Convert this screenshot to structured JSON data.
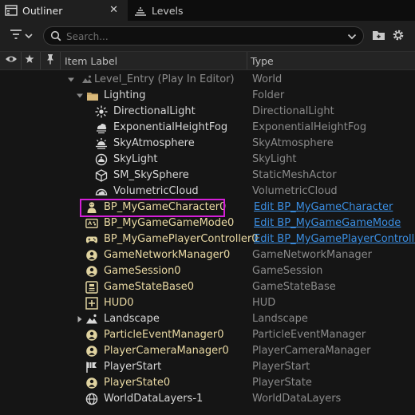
{
  "tabs": [
    {
      "label": "Outliner",
      "icon": "outliner-icon",
      "active": true,
      "close": "✕"
    },
    {
      "label": "Levels",
      "icon": "levels-icon",
      "active": false
    }
  ],
  "toolbar": {
    "search_placeholder": "Search...",
    "filter_icon": "filter-icon",
    "add_folder_icon": "add-folder-icon",
    "settings_icon": "gear-icon"
  },
  "columns": {
    "visibility_icon": "eye-icon",
    "favorite_icon": "star-icon",
    "pin_icon": "pin-icon",
    "item_label": "Item Label",
    "type": "Type"
  },
  "rows": [
    {
      "label": "Level_Entry (Play In Editor)",
      "type": "World",
      "icon": "world-icon",
      "twisty": "expanded",
      "style": "dim"
    },
    {
      "label": "Lighting",
      "type": "Folder",
      "icon": "folder-icon",
      "twisty": "expanded",
      "style": "white"
    },
    {
      "label": "DirectionalLight",
      "type": "DirectionalLight",
      "icon": "directional-light-icon",
      "style": "white"
    },
    {
      "label": "ExponentialHeightFog",
      "type": "ExponentialHeightFog",
      "icon": "height-fog-icon",
      "style": "white"
    },
    {
      "label": "SkyAtmosphere",
      "type": "SkyAtmosphere",
      "icon": "sky-atmosphere-icon",
      "style": "white"
    },
    {
      "label": "SkyLight",
      "type": "SkyLight",
      "icon": "sky-light-icon",
      "style": "white"
    },
    {
      "label": "SM_SkySphere",
      "type": "StaticMeshActor",
      "icon": "static-mesh-icon",
      "style": "white"
    },
    {
      "label": "VolumetricCloud",
      "type": "VolumetricCloud",
      "icon": "volumetric-cloud-icon",
      "style": "white"
    },
    {
      "label": "BP_MyGameCharacter0",
      "type": "Edit BP_MyGameCharacter",
      "icon": "character-icon",
      "style": "yellow",
      "link": true,
      "highlighted": true
    },
    {
      "label": "BP_MyGameGameMode0",
      "type": "Edit BP_MyGameGameMode",
      "icon": "game-mode-icon",
      "style": "yellow",
      "link": true
    },
    {
      "label": "BP_MyGamePlayerController0",
      "type": "Edit BP_MyGamePlayerController",
      "icon": "gamepad-icon",
      "style": "yellow",
      "link": true
    },
    {
      "label": "GameNetworkManager0",
      "type": "GameNetworkManager",
      "icon": "actor-icon",
      "style": "yellow"
    },
    {
      "label": "GameSession0",
      "type": "GameSession",
      "icon": "actor-icon",
      "style": "yellow"
    },
    {
      "label": "GameStateBase0",
      "type": "GameStateBase",
      "icon": "game-state-icon",
      "style": "yellow"
    },
    {
      "label": "HUD0",
      "type": "HUD",
      "icon": "hud-icon",
      "style": "yellow"
    },
    {
      "label": "Landscape",
      "type": "Landscape",
      "icon": "landscape-icon",
      "twisty": "collapsed",
      "style": "white"
    },
    {
      "label": "ParticleEventManager0",
      "type": "ParticleEventManager",
      "icon": "actor-icon",
      "style": "yellow"
    },
    {
      "label": "PlayerCameraManager0",
      "type": "PlayerCameraManager",
      "icon": "actor-icon",
      "style": "yellow"
    },
    {
      "label": "PlayerStart",
      "type": "PlayerStart",
      "icon": "player-start-icon",
      "style": "white"
    },
    {
      "label": "PlayerState0",
      "type": "PlayerState",
      "icon": "actor-icon",
      "style": "yellow"
    },
    {
      "label": "WorldDataLayers-1",
      "type": "WorldDataLayers",
      "icon": "world-data-layers-icon",
      "style": "white"
    }
  ],
  "colors": {
    "link": "#3b8fe3",
    "highlight_box": "#d41fd8",
    "actor_label": "#e9d9a3"
  }
}
